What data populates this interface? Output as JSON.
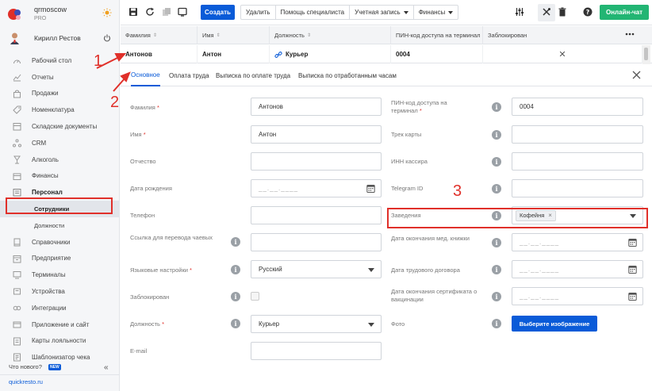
{
  "brand": {
    "name": "qrmoscow",
    "plan": "PRO"
  },
  "user": {
    "name": "Кирилл Рестов"
  },
  "sidebar": {
    "items": [
      {
        "label": "Рабочий стол",
        "icon": "dashboard-icon"
      },
      {
        "label": "Отчеты",
        "icon": "reports-icon"
      },
      {
        "label": "Продажи",
        "icon": "sales-icon"
      },
      {
        "label": "Номенклатура",
        "icon": "nomenclature-icon"
      },
      {
        "label": "Складские документы",
        "icon": "warehouse-icon"
      },
      {
        "label": "CRM",
        "icon": "crm-icon"
      },
      {
        "label": "Алкоголь",
        "icon": "alcohol-icon"
      },
      {
        "label": "Финансы",
        "icon": "finance-icon"
      },
      {
        "label": "Персонал",
        "icon": "staff-icon"
      },
      {
        "label": "Сотрудники"
      },
      {
        "label": "Должности"
      },
      {
        "label": "Справочники",
        "icon": "directory-icon"
      },
      {
        "label": "Предприятие",
        "icon": "enterprise-icon"
      },
      {
        "label": "Терминалы",
        "icon": "terminal-icon"
      },
      {
        "label": "Устройства",
        "icon": "device-icon"
      },
      {
        "label": "Интеграции",
        "icon": "integration-icon"
      },
      {
        "label": "Приложение и сайт",
        "icon": "app-icon"
      },
      {
        "label": "Карты лояльности",
        "icon": "loyalty-card-icon"
      },
      {
        "label": "Шаблонизатор чека",
        "icon": "receipt-template-icon"
      }
    ],
    "whats_new": "Что нового?",
    "new_badge": "NEW",
    "footer_link": "quickresto.ru"
  },
  "toolbar": {
    "create": "Создать",
    "delete": "Удалить",
    "help": "Помощь специалиста",
    "account": "Учетная запись",
    "finance": "Финансы",
    "chat": "Онлайн-чат"
  },
  "table": {
    "columns": [
      "Фамилия",
      "Имя",
      "Должность",
      "ПИН-код доступа на терминал",
      "Заблокирован"
    ],
    "row": {
      "lastname": "Антонов",
      "firstname": "Антон",
      "position": "Курьер",
      "pin": "0004",
      "blocked": "✕"
    }
  },
  "tabs": [
    "Основное",
    "Оплата труда",
    "Выписка по оплате труда",
    "Выписка по отработанным часам"
  ],
  "form": {
    "lastname_label": "Фамилия",
    "lastname_value": "Антонов",
    "firstname_label": "Имя",
    "firstname_value": "Антон",
    "middlename_label": "Отчество",
    "birthdate_label": "Дата рождения",
    "date_placeholder": "__.__.____",
    "phone_label": "Телефон",
    "tips_label": "Ссылка для перевода чаевых",
    "lang_label": "Языковые настройки",
    "lang_value": "Русский",
    "blocked_label": "Заблокирован",
    "position_label": "Должность",
    "position_value": "Курьер",
    "email_label": "E-mail",
    "pin_label": "ПИН-код доступа на терминал",
    "pin_value": "0004",
    "track_label": "Трек карты",
    "inn_label": "ИНН кассира",
    "telegram_label": "Telegram ID",
    "venue_label": "Заведения",
    "venue_chip": "Кофейня",
    "medbook_label": "Дата окончания мед. книжки",
    "contract_label": "Дата трудового договора",
    "vaccine_label": "Дата окончания сертификата о вакцинации",
    "photo_label": "Фото",
    "photo_button": "Выберите изображение"
  },
  "annotations": [
    "1",
    "2",
    "3"
  ],
  "colors": {
    "accent": "#0a5bd8",
    "chat": "#22b573",
    "annotation": "#e0302a",
    "required": "#e0302a"
  }
}
